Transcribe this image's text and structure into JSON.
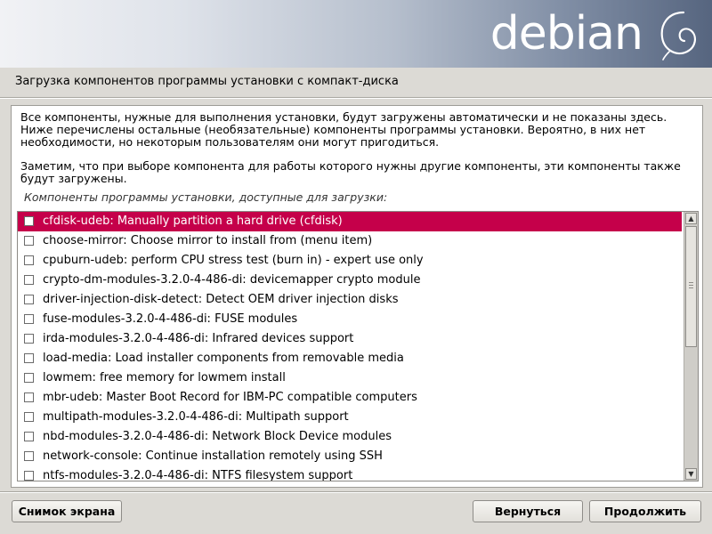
{
  "header": {
    "logo_text": "debian",
    "title": "Загрузка компонентов программы установки с компакт-диска"
  },
  "content": {
    "paragraph1": "Все компоненты, нужные для выполнения установки, будут загружены автоматически и не показаны здесь. Ниже перечислены остальные (необязательные) компоненты программы установки. Вероятно, в них нет необходимости, но некоторым пользователям они могут пригодиться.",
    "paragraph2": "Заметим, что при выборе компонента для работы которого нужны другие компоненты, эти компоненты также будут загружены.",
    "list_caption": "Компоненты программы установки, доступные для загрузки:"
  },
  "components": [
    {
      "label": "cfdisk-udeb: Manually partition a hard drive (cfdisk)",
      "checked": false,
      "selected": true
    },
    {
      "label": "choose-mirror: Choose mirror to install from (menu item)",
      "checked": false,
      "selected": false
    },
    {
      "label": "cpuburn-udeb: perform CPU stress test (burn in) - expert use only",
      "checked": false,
      "selected": false
    },
    {
      "label": "crypto-dm-modules-3.2.0-4-486-di: devicemapper crypto module",
      "checked": false,
      "selected": false
    },
    {
      "label": "driver-injection-disk-detect: Detect OEM driver injection disks",
      "checked": false,
      "selected": false
    },
    {
      "label": "fuse-modules-3.2.0-4-486-di: FUSE modules",
      "checked": false,
      "selected": false
    },
    {
      "label": "irda-modules-3.2.0-4-486-di: Infrared devices support",
      "checked": false,
      "selected": false
    },
    {
      "label": "load-media: Load installer components from removable media",
      "checked": false,
      "selected": false
    },
    {
      "label": "lowmem: free memory for lowmem install",
      "checked": false,
      "selected": false
    },
    {
      "label": "mbr-udeb: Master Boot Record for IBM-PC compatible computers",
      "checked": false,
      "selected": false
    },
    {
      "label": "multipath-modules-3.2.0-4-486-di: Multipath support",
      "checked": false,
      "selected": false
    },
    {
      "label": "nbd-modules-3.2.0-4-486-di: Network Block Device modules",
      "checked": false,
      "selected": false
    },
    {
      "label": "network-console: Continue installation remotely using SSH",
      "checked": false,
      "selected": false
    },
    {
      "label": "ntfs-modules-3.2.0-4-486-di: NTFS filesystem support",
      "checked": false,
      "selected": false
    }
  ],
  "buttons": {
    "screenshot": "Снимок экрана",
    "back": "Вернуться",
    "continue": "Продолжить"
  },
  "colors": {
    "selection": "#c5004a",
    "background": "#dcdad5"
  }
}
